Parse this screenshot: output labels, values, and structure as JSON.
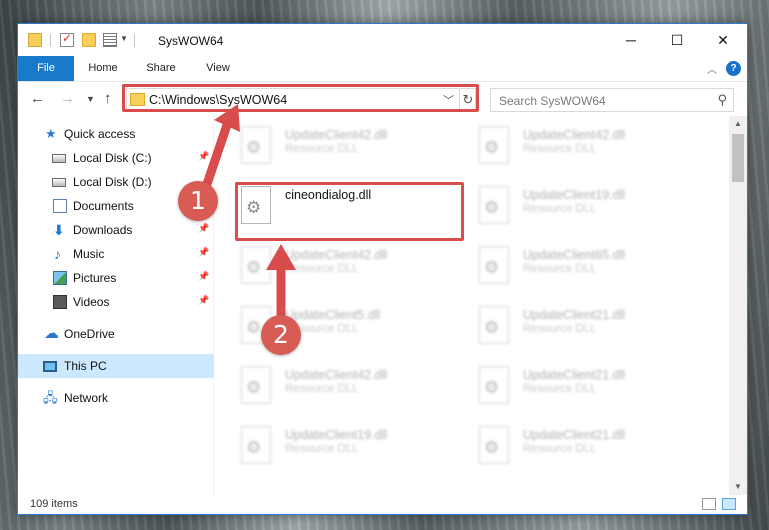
{
  "window": {
    "title": "SysWOW64",
    "controls": {
      "minimize": "─",
      "maximize": "☐",
      "close": "✕"
    }
  },
  "ribbon": {
    "tabs": [
      "File",
      "Home",
      "Share",
      "View"
    ],
    "help": "?"
  },
  "address_bar": {
    "path": "C:\\Windows\\SysWOW64",
    "refresh_icon": "↻"
  },
  "search": {
    "placeholder": "Search SysWOW64"
  },
  "sidebar": {
    "items": [
      {
        "label": "Quick access",
        "icon": "star-icon",
        "pinned": false
      },
      {
        "label": "Local Disk (C:)",
        "icon": "disk-icon",
        "pinned": true
      },
      {
        "label": "Local Disk (D:)",
        "icon": "disk-icon",
        "pinned": false
      },
      {
        "label": "Documents",
        "icon": "documents-icon",
        "pinned": true
      },
      {
        "label": "Downloads",
        "icon": "download-icon",
        "pinned": true
      },
      {
        "label": "Music",
        "icon": "music-icon",
        "pinned": true
      },
      {
        "label": "Pictures",
        "icon": "pictures-icon",
        "pinned": true
      },
      {
        "label": "Videos",
        "icon": "videos-icon",
        "pinned": true
      },
      {
        "label": "OneDrive",
        "icon": "cloud-icon",
        "pinned": false
      },
      {
        "label": "This PC",
        "icon": "pc-icon",
        "pinned": false,
        "selected": true
      },
      {
        "label": "Network",
        "icon": "network-icon",
        "pinned": false
      }
    ]
  },
  "files": {
    "left_column": [
      {
        "name": "UpdateClient42.dll",
        "type": "Resource DLL"
      },
      {
        "name": "cineondialog.dll",
        "type": ""
      },
      {
        "name": "UpdateClient42.dll",
        "type": "Resource DLL"
      },
      {
        "name": "UpdateClient5.dll",
        "type": "Resource DLL"
      },
      {
        "name": "UpdateClient42.dll",
        "type": "Resource DLL"
      },
      {
        "name": "UpdateClient19.dll",
        "type": "Resource DLL"
      }
    ],
    "right_column": [
      {
        "name": "UpdateClient42.dll",
        "type": "Resource DLL"
      },
      {
        "name": "UpdateClient19.dll",
        "type": "Resource DLL"
      },
      {
        "name": "UpdateClient65.dll",
        "type": "Resource DLL"
      },
      {
        "name": "UpdateClient21.dll",
        "type": "Resource DLL"
      },
      {
        "name": "UpdateClient21.dll",
        "type": "Resource DLL"
      },
      {
        "name": "UpdateClient21.dll",
        "type": "Resource DLL"
      }
    ]
  },
  "status": {
    "item_count": "109 items"
  },
  "annotations": {
    "step1": "1",
    "step2": "2",
    "color": "#d94c4c"
  }
}
